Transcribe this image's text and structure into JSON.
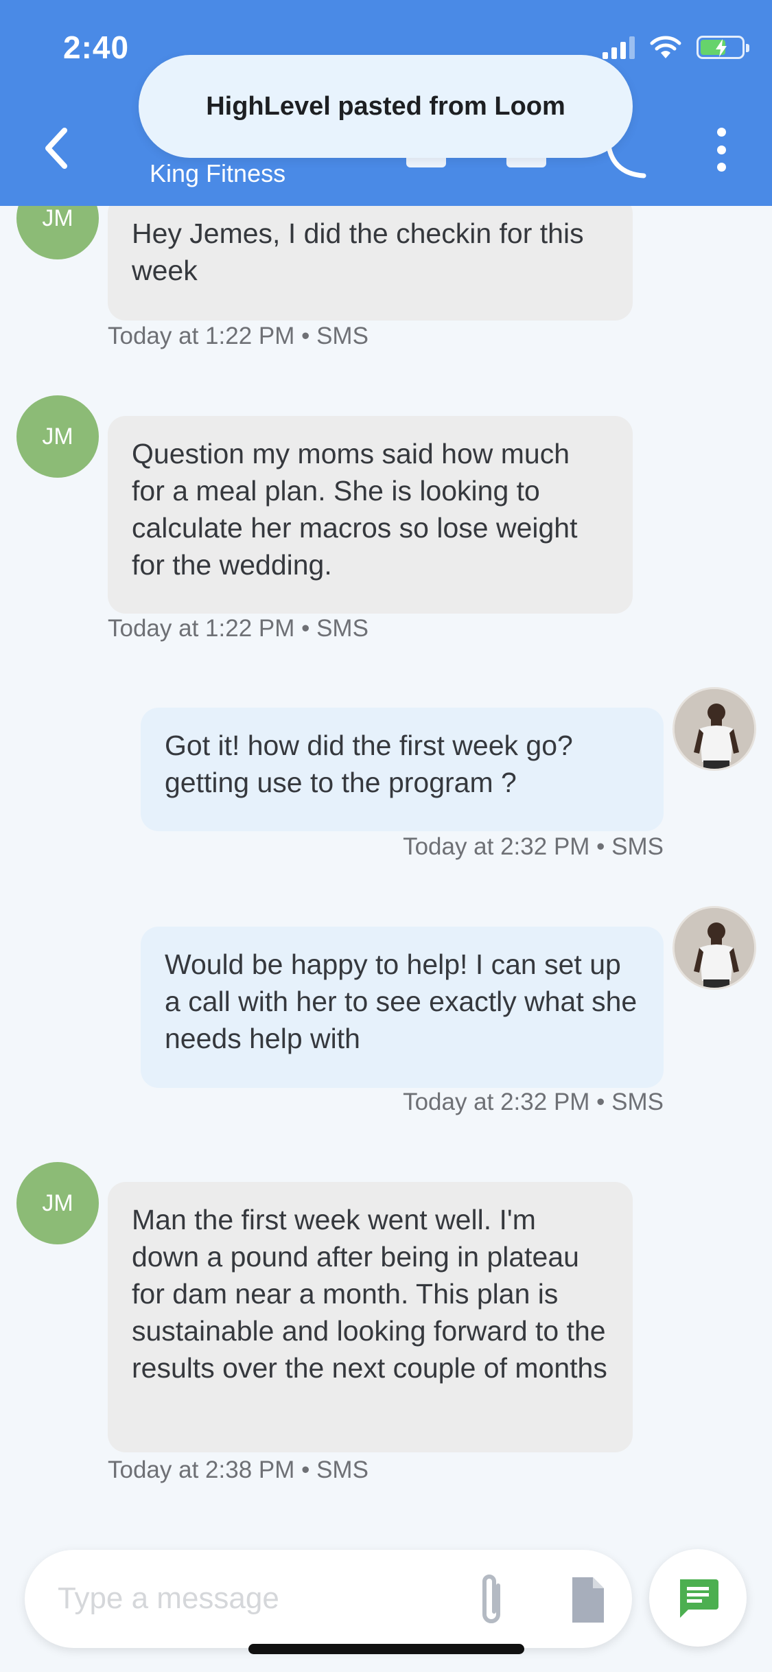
{
  "status_bar": {
    "time": "2:40"
  },
  "header": {
    "contact_name": "King Fitness"
  },
  "toast": {
    "text": "HighLevel pasted from Loom"
  },
  "messages": [
    {
      "direction": "incoming",
      "avatar": "JM",
      "text": "Hey Jemes, I did the checkin for this week",
      "meta": "Today at 1:22 PM • SMS"
    },
    {
      "direction": "incoming",
      "avatar": "JM",
      "text": "Question my moms said how much for a meal plan. She is looking to calculate her macros so lose weight for the wedding.",
      "meta": "Today at 1:22 PM • SMS"
    },
    {
      "direction": "outgoing",
      "text": "Got it! how did the first week go? getting use to the program ?",
      "meta": "Today at 2:32 PM • SMS"
    },
    {
      "direction": "outgoing",
      "text": "Would be happy to help! I can set up a call with her to see exactly what she needs help with",
      "meta": "Today at 2:32 PM • SMS"
    },
    {
      "direction": "incoming",
      "avatar": "JM",
      "text": "Man the first week went well. I'm down a pound after being in plateau for dam near a month. This plan is sustainable and looking forward to the results over the next couple of months",
      "meta": "Today at 2:38 PM • SMS"
    }
  ],
  "composer": {
    "placeholder": "Type a message"
  },
  "colors": {
    "header": "#4a8ae6",
    "incoming_bubble": "#ececec",
    "outgoing_bubble": "#e6f1fb",
    "avatar": "#8cbb76",
    "send_icon": "#4caf50"
  }
}
